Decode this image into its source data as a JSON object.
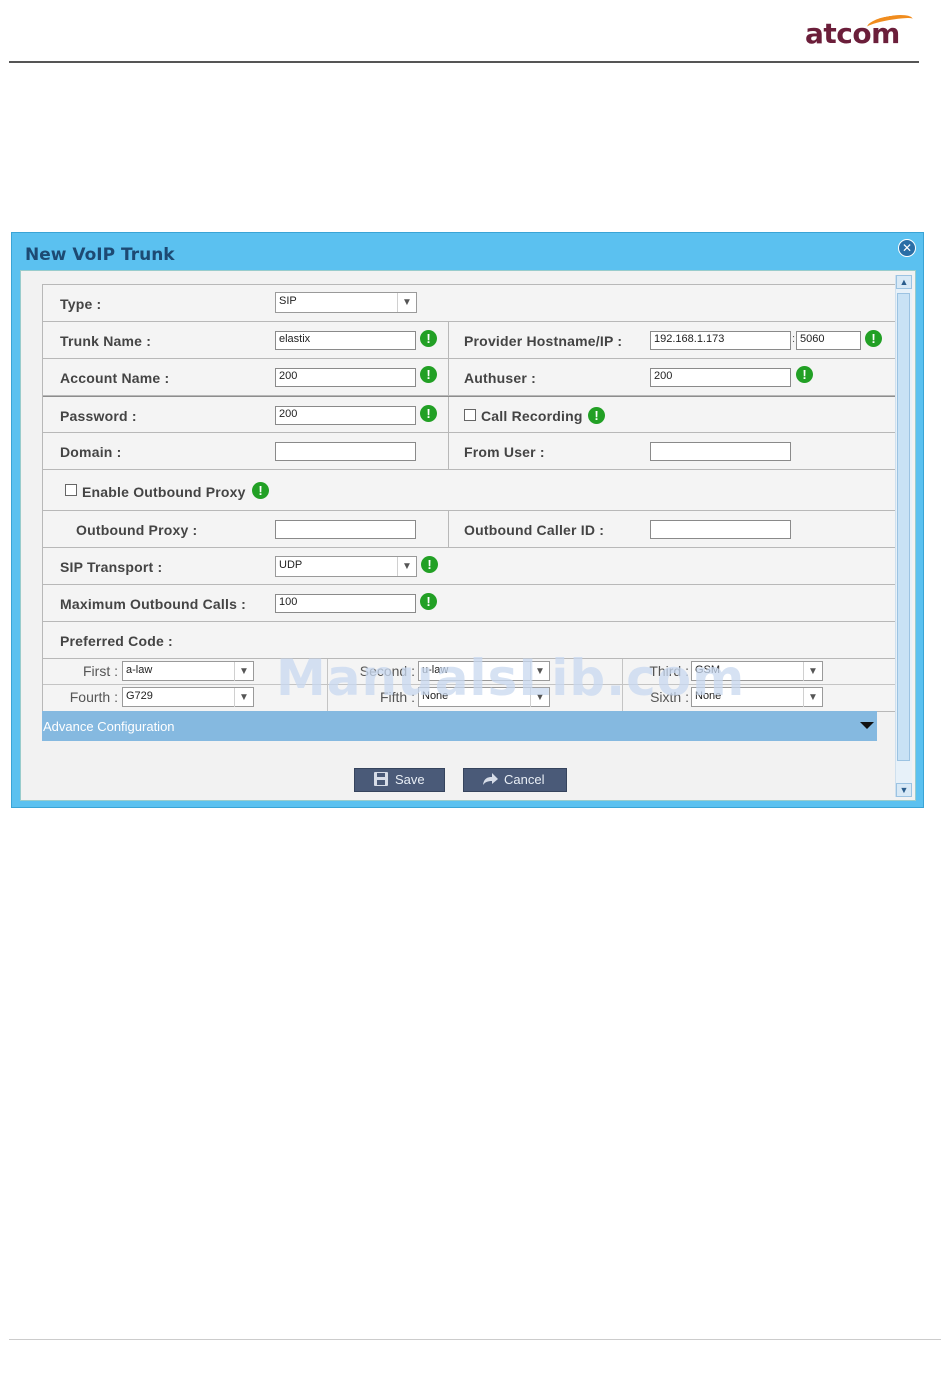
{
  "brand": {
    "logo_text": "atcom"
  },
  "watermark": "ManualsLib.com",
  "dialog": {
    "title": "New VoIP Trunk",
    "close_icon": "close-icon"
  },
  "form": {
    "type": {
      "label": "Type :",
      "value": "SIP"
    },
    "trunk_name": {
      "label": "Trunk Name :",
      "value": "elastix"
    },
    "provider_host": {
      "label": "Provider Hostname/IP :",
      "value": "192.168.1.173",
      "port": "5060"
    },
    "account_name": {
      "label": "Account Name :",
      "value": "200"
    },
    "authuser": {
      "label": "Authuser :",
      "value": "200"
    },
    "password": {
      "label": "Password :",
      "value": "200"
    },
    "call_recording": {
      "label": "Call Recording",
      "checked": false
    },
    "domain": {
      "label": "Domain :",
      "value": ""
    },
    "from_user": {
      "label": "From User :",
      "value": ""
    },
    "enable_outbound_proxy": {
      "label": "Enable Outbound Proxy",
      "checked": false
    },
    "outbound_proxy": {
      "label": "Outbound Proxy :",
      "value": ""
    },
    "outbound_caller_id": {
      "label": "Outbound Caller ID :",
      "value": ""
    },
    "sip_transport": {
      "label": "SIP Transport :",
      "value": "UDP"
    },
    "max_outbound_calls": {
      "label": "Maximum Outbound Calls :",
      "value": "100"
    },
    "preferred_code": {
      "label": "Preferred Code :",
      "codecs": [
        {
          "label": "First :",
          "value": "a-law"
        },
        {
          "label": "Second :",
          "value": "u-law"
        },
        {
          "label": "Third :",
          "value": "GSM"
        },
        {
          "label": "Fourth :",
          "value": "G729"
        },
        {
          "label": "Fifth :",
          "value": "None"
        },
        {
          "label": "Sixth :",
          "value": "None"
        }
      ]
    }
  },
  "advance": {
    "label": "Advance Configuration"
  },
  "buttons": {
    "save": "Save",
    "cancel": "Cancel"
  },
  "colors": {
    "dialog_frame": "#5bc1f0",
    "title": "#1d4a73",
    "ok_icon": "#22a025",
    "advance_bar": "#85b9e0",
    "button": "#4a5a78"
  }
}
